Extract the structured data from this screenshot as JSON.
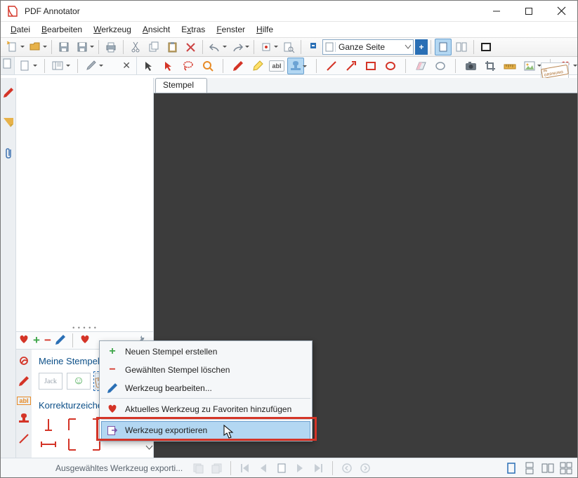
{
  "window": {
    "title": "PDF Annotator"
  },
  "menu": {
    "items": [
      "Datei",
      "Bearbeiten",
      "Werkzeug",
      "Ansicht",
      "Extras",
      "Fenster",
      "Hilfe"
    ]
  },
  "zoom": {
    "label": "Ganze Seite"
  },
  "doc_tabs": {
    "active": "Stempel"
  },
  "side": {
    "cat1_title": "Meine Stempel",
    "cat2_title": "Korrekturzeichen",
    "thumb_jack": "Jack",
    "thumb_stamp_text": "IN ORDNUNG",
    "preview_stamp_text": "IN ORDNUNG"
  },
  "ctx": {
    "new_stamp": "Neuen Stempel erstellen",
    "delete": "Gewählten Stempel löschen",
    "edit": "Werkzeug bearbeiten...",
    "fav": "Aktuelles Werkzeug zu Favoriten hinzufügen",
    "export": "Werkzeug exportieren"
  },
  "status": {
    "text": "Ausgewähltes Werkzeug exporti..."
  }
}
